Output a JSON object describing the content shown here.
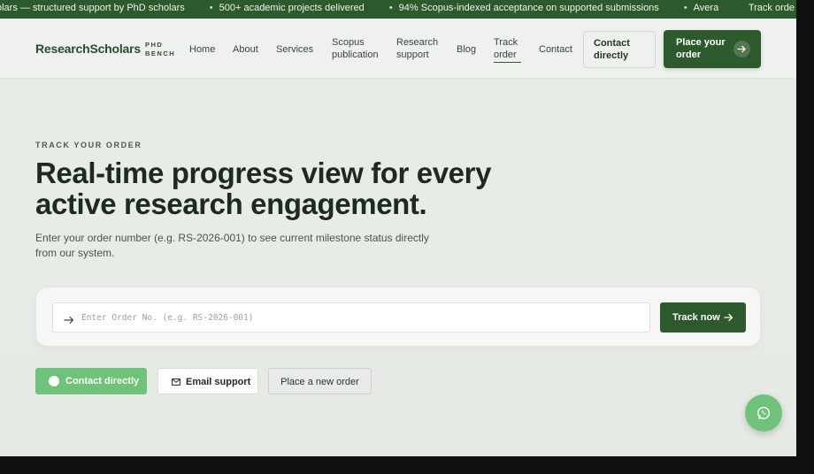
{
  "ticker": {
    "items": [
      "olars — structured support by PhD scholars",
      "500+ academic projects delivered",
      "94% Scopus-indexed acceptance on supported submissions",
      "Avera"
    ],
    "end_text": "Track orde"
  },
  "header": {
    "logo": "ResearchScholars",
    "logo_sub": "PHD BENCH",
    "nav": [
      {
        "label": "Home"
      },
      {
        "label": "About"
      },
      {
        "label": "Services"
      },
      {
        "label": "Scopus publication"
      },
      {
        "label": "Research support"
      },
      {
        "label": "Blog"
      },
      {
        "label": "Track order",
        "active": true
      },
      {
        "label": "Contact"
      }
    ],
    "contact_button": "Contact directly",
    "place_order_button": "Place your order"
  },
  "hero": {
    "eyebrow": "TRACK YOUR ORDER",
    "title": "Real-time progress view for every active research engagement.",
    "subtitle": "Enter your order number (e.g. RS-2026-001) to see current milestone status directly from our system."
  },
  "tracker": {
    "placeholder": "Enter Order No. (e.g. RS-2026-001)",
    "value": "",
    "button": "Track now"
  },
  "actions": {
    "contact": "Contact directly",
    "email": "Email support",
    "new_order": "Place a new order"
  },
  "colors": {
    "brand": "#2c5a2c",
    "accent_green": "#6fc279",
    "background": "#e6ebe6"
  },
  "icons": {
    "ticker_separator": "bullet",
    "input_prefix": "arrow-right-icon",
    "track_button": "arrow-right-icon",
    "contact": "whatsapp-icon",
    "email": "mail-icon",
    "fab": "whatsapp-icon"
  }
}
